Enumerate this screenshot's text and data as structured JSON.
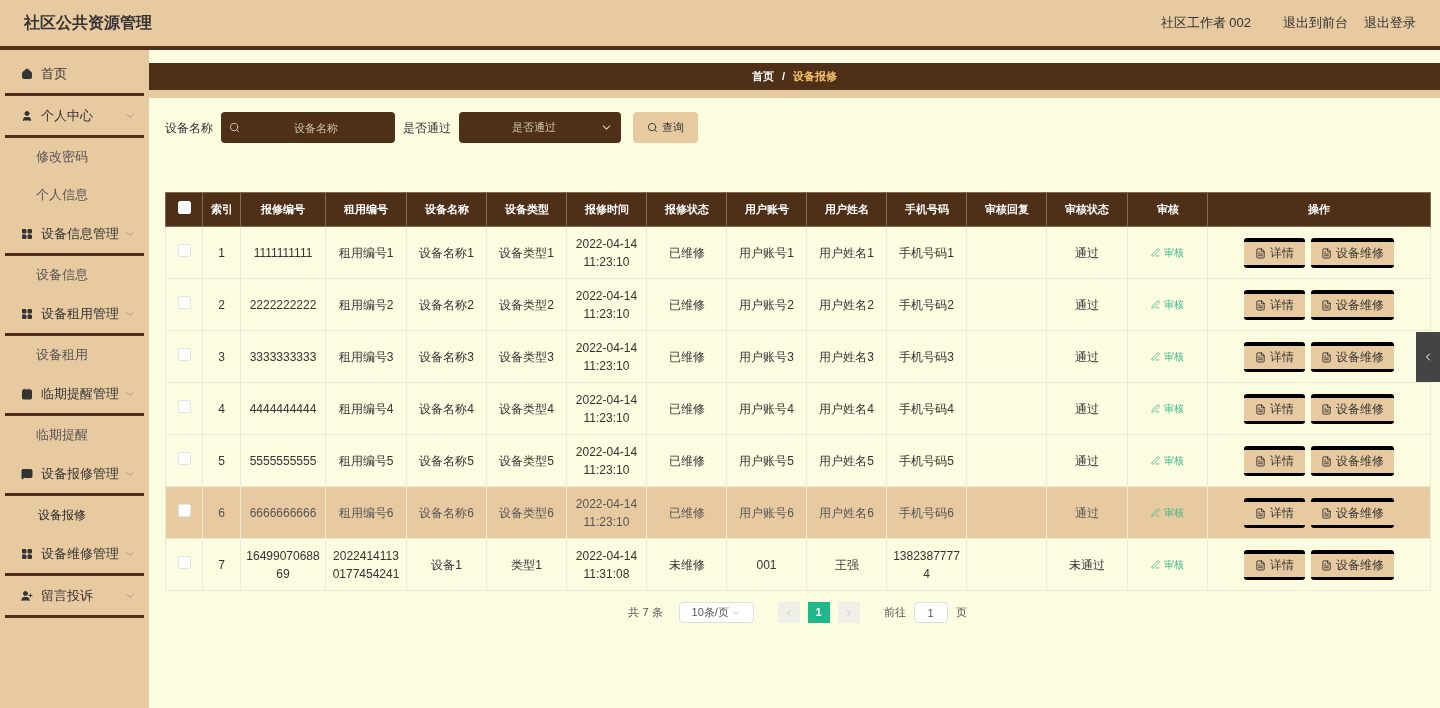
{
  "header": {
    "title": "社区公共资源管理",
    "user": "社区工作者 002",
    "links": [
      "退出到前台",
      "退出登录"
    ]
  },
  "sidebar": {
    "items": [
      {
        "label": "首页",
        "kind": "link"
      },
      {
        "label": "个人中心",
        "kind": "menu",
        "children": [
          {
            "label": "修改密码",
            "selected": false
          },
          {
            "label": "个人信息",
            "selected": false
          }
        ]
      },
      {
        "label": "设备信息管理",
        "kind": "menu",
        "children": [
          {
            "label": "设备信息",
            "selected": false
          }
        ]
      },
      {
        "label": "设备租用管理",
        "kind": "menu",
        "children": [
          {
            "label": "设备租用",
            "selected": false
          }
        ]
      },
      {
        "label": "临期提醒管理",
        "kind": "menu",
        "children": [
          {
            "label": "临期提醒",
            "selected": false
          }
        ]
      },
      {
        "label": "设备报修管理",
        "kind": "menu",
        "children": [
          {
            "label": "设备报修",
            "selected": true
          }
        ]
      },
      {
        "label": "设备维修管理",
        "kind": "menu"
      },
      {
        "label": "留言投诉",
        "kind": "menu"
      }
    ]
  },
  "breadcrumb": {
    "home": "首页",
    "separator": "/",
    "current": "设备报修"
  },
  "search": {
    "name_label": "设备名称",
    "name_placeholder": "设备名称",
    "pass_label": "是否通过",
    "pass_placeholder": "是否通过",
    "button": "查询"
  },
  "table": {
    "columns": [
      "索引",
      "报修编号",
      "租用编号",
      "设备名称",
      "设备类型",
      "报修时间",
      "报修状态",
      "用户账号",
      "用户姓名",
      "手机号码",
      "审核回复",
      "审核状态",
      "审核",
      "操作"
    ],
    "header_checked": false,
    "rows": [
      {
        "checked": false,
        "highlighted": false,
        "cells": [
          "1",
          "1111111111",
          "租用编号1",
          "设备名称1",
          "设备类型1",
          "2022-04-14 11:23:10",
          "已维修",
          "用户账号1",
          "用户姓名1",
          "手机号码1",
          "",
          "通过"
        ],
        "review": "审核",
        "actions": [
          "详情",
          "设备维修"
        ]
      },
      {
        "checked": false,
        "highlighted": false,
        "cells": [
          "2",
          "2222222222",
          "租用编号2",
          "设备名称2",
          "设备类型2",
          "2022-04-14 11:23:10",
          "已维修",
          "用户账号2",
          "用户姓名2",
          "手机号码2",
          "",
          "通过"
        ],
        "review": "审核",
        "actions": [
          "详情",
          "设备维修"
        ]
      },
      {
        "checked": false,
        "highlighted": false,
        "cells": [
          "3",
          "3333333333",
          "租用编号3",
          "设备名称3",
          "设备类型3",
          "2022-04-14 11:23:10",
          "已维修",
          "用户账号3",
          "用户姓名3",
          "手机号码3",
          "",
          "通过"
        ],
        "review": "审核",
        "actions": [
          "详情",
          "设备维修"
        ]
      },
      {
        "checked": false,
        "highlighted": false,
        "cells": [
          "4",
          "4444444444",
          "租用编号4",
          "设备名称4",
          "设备类型4",
          "2022-04-14 11:23:10",
          "已维修",
          "用户账号4",
          "用户姓名4",
          "手机号码4",
          "",
          "通过"
        ],
        "review": "审核",
        "actions": [
          "详情",
          "设备维修"
        ]
      },
      {
        "checked": false,
        "highlighted": false,
        "cells": [
          "5",
          "5555555555",
          "租用编号5",
          "设备名称5",
          "设备类型5",
          "2022-04-14 11:23:10",
          "已维修",
          "用户账号5",
          "用户姓名5",
          "手机号码5",
          "",
          "通过"
        ],
        "review": "审核",
        "actions": [
          "详情",
          "设备维修"
        ]
      },
      {
        "checked": false,
        "highlighted": true,
        "cells": [
          "6",
          "6666666666",
          "租用编号6",
          "设备名称6",
          "设备类型6",
          "2022-04-14 11:23:10",
          "已维修",
          "用户账号6",
          "用户姓名6",
          "手机号码6",
          "",
          "通过"
        ],
        "review": "审核",
        "actions": [
          "详情",
          "设备维修"
        ]
      },
      {
        "checked": false,
        "highlighted": false,
        "cells": [
          "7",
          "1649907068869",
          "20224141130177454241",
          "设备1",
          "类型1",
          "2022-04-14 11:31:08",
          "未维修",
          "001",
          "王强",
          "13823877774",
          "",
          "未通过"
        ],
        "review": "审核",
        "actions": [
          "详情",
          "设备维修"
        ]
      }
    ]
  },
  "pagination": {
    "total": "共 7 条",
    "page_size": "10条/页",
    "pages": [
      {
        "label": "1",
        "selected": true
      }
    ],
    "goto_label": "前往",
    "goto_value": "1",
    "page_suffix": "页"
  }
}
